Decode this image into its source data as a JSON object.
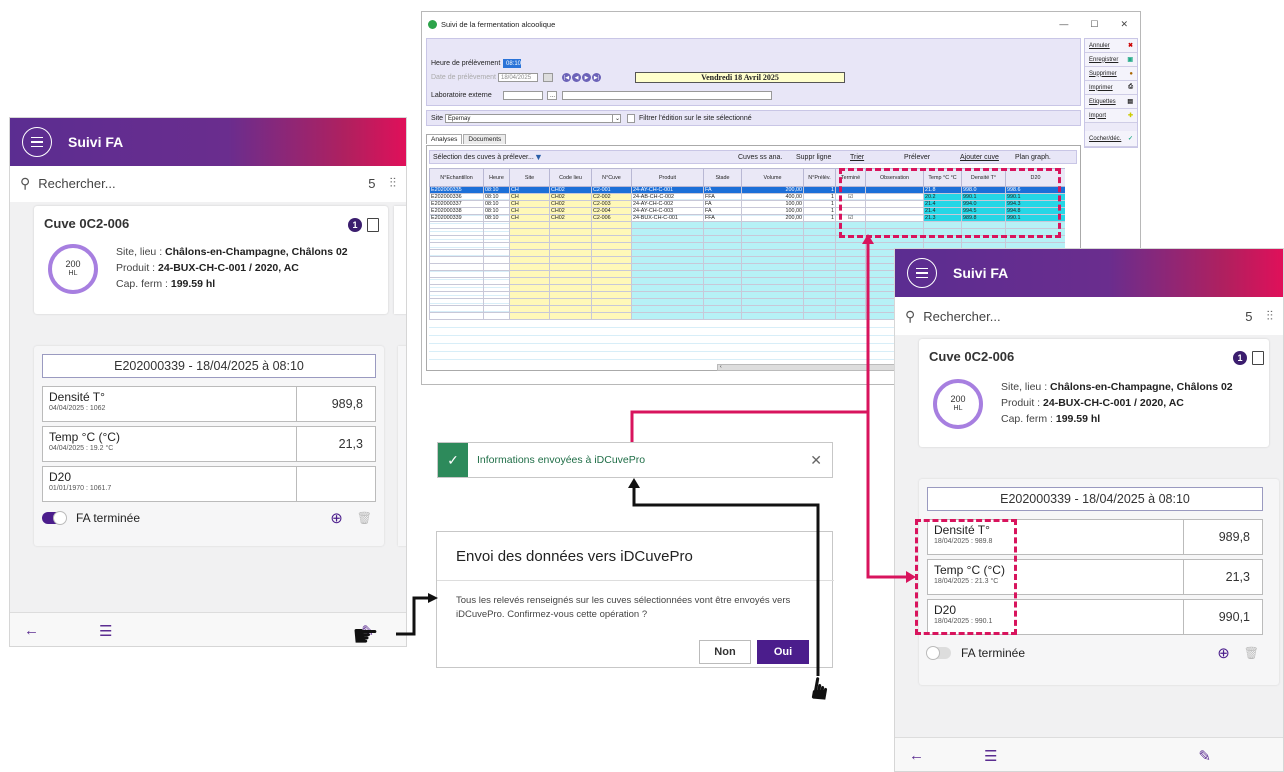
{
  "app_bar_title": "Suivi FA",
  "search_placeholder": "Rechercher...",
  "result_count": "5",
  "cuve": {
    "title": "Cuve 0C2-006",
    "badge_count": "1",
    "capacity_value": "200",
    "capacity_unit": "HL",
    "site_label": "Site, lieu : ",
    "site_value": "Châlons-en-Champagne, Châlons 02",
    "product_label": "Produit : ",
    "product_value": "24-BUX-CH-C-001 / 2020, AC",
    "cap_label": "Cap. ferm : ",
    "cap_value": "199.59 hl"
  },
  "sample_header": "E202000339 - 18/04/2025 à 08:10",
  "left_measurements": [
    {
      "name": "Densité T°",
      "sub": "04/04/2025 : 1062",
      "value": "989,8"
    },
    {
      "name": "Temp °C (°C)",
      "sub": "04/04/2025 : 19.2 °C",
      "value": "21,3"
    },
    {
      "name": "D20",
      "sub": "01/01/1970 : 1061.7",
      "value": ""
    }
  ],
  "right_measurements": [
    {
      "name": "Densité T°",
      "sub": "18/04/2025 : 989.8",
      "value": "989,8"
    },
    {
      "name": "Temp °C (°C)",
      "sub": "18/04/2025 : 21.3 °C",
      "value": "21,3"
    },
    {
      "name": "D20",
      "sub": "18/04/2025 : 990.1",
      "value": "990,1"
    }
  ],
  "fa_toggle_label": "FA terminée",
  "desktop": {
    "window_title": "Suivi de la fermentation alcoolique",
    "win_controls": [
      "—",
      "☐",
      "✕"
    ],
    "heure_label": "Heure de prélèvement",
    "heure_value": "08:10",
    "date_label": "Date de prélèvement",
    "date_value": "18/04/2025",
    "date_display": "Vendredi 18 Avril 2025",
    "labo_label": "Laboratoire externe",
    "site_label": "Site",
    "site_value": "Epernay",
    "filter_label": "Filtrer l'édition sur le site sélectionné",
    "tab_analyses": "Analyses",
    "tab_documents": "Documents",
    "selection_label": "Sélection des cuves à prélever...",
    "toolbar": [
      "Cuves ss ana.",
      "Suppr ligne",
      "Trier",
      "Prélever",
      "Ajouter cuve",
      "Plan graph."
    ],
    "side_buttons": [
      "Annuler",
      "Enregistrer",
      "Supprimer",
      "Imprimer",
      "Etiquettes",
      "Import",
      "Cocher/déc."
    ],
    "columns": [
      "N°Echantillon",
      "Heure",
      "Site",
      "Code lieu",
      "N°Cuve",
      "Produit",
      "Stade",
      "Volume",
      "N°Prélèv.",
      "Terminé",
      "Observation",
      "Temp °C °C",
      "Densité T°",
      "D20"
    ],
    "rows": [
      [
        "E202000335",
        "08:10",
        "CH",
        "CH02",
        "C2-001",
        "24-AY-CH-C-001",
        "FA",
        "200,00",
        "1",
        "",
        "",
        "21.8",
        "998.0",
        "998.6"
      ],
      [
        "E202000336",
        "08:10",
        "CH",
        "CH02",
        "C2-002",
        "24-AB-CH-C-002",
        "FFA",
        "400,00",
        "1",
        "☑",
        "",
        "20.2",
        "990.1",
        "990.1"
      ],
      [
        "E202000337",
        "08:10",
        "CH",
        "CH02",
        "C2-003",
        "24-AY-CH-C-002",
        "FA",
        "100,00",
        "1",
        "",
        "",
        "21.4",
        "994.0",
        "994.3"
      ],
      [
        "E202000338",
        "08:10",
        "CH",
        "CH02",
        "C2-004",
        "24-AY-CH-C-003",
        "FA",
        "100,00",
        "1",
        "",
        "",
        "21.4",
        "994.5",
        "994.8"
      ],
      [
        "E202000339",
        "08:10",
        "CH",
        "CH02",
        "C2-006",
        "24-BUX-CH-C-001",
        "FFA",
        "200,00",
        "1",
        "☑",
        "",
        "21.3",
        "989.8",
        "990.1"
      ]
    ]
  },
  "toast": {
    "message": "Informations envoyées à iDCuvePro"
  },
  "dialog": {
    "title": "Envoi des données vers iDCuvePro",
    "body": "Tous les relevés renseignés sur les cuves sélectionnées vont être envoyés vers iDCuvePro. Confirmez-vous cette opération ?",
    "no_label": "Non",
    "yes_label": "Oui"
  },
  "colors": {
    "accent": "#5b2d91",
    "highlight": "#d8145d",
    "success": "#2d8a5b"
  },
  "icons": [
    "menu-icon",
    "search-icon",
    "filter-icon",
    "document-icon",
    "back-arrow-icon",
    "list-icon",
    "send-data-icon",
    "add-circle-icon",
    "trash-icon",
    "check-icon",
    "close-icon",
    "pointing-hand-icon"
  ]
}
